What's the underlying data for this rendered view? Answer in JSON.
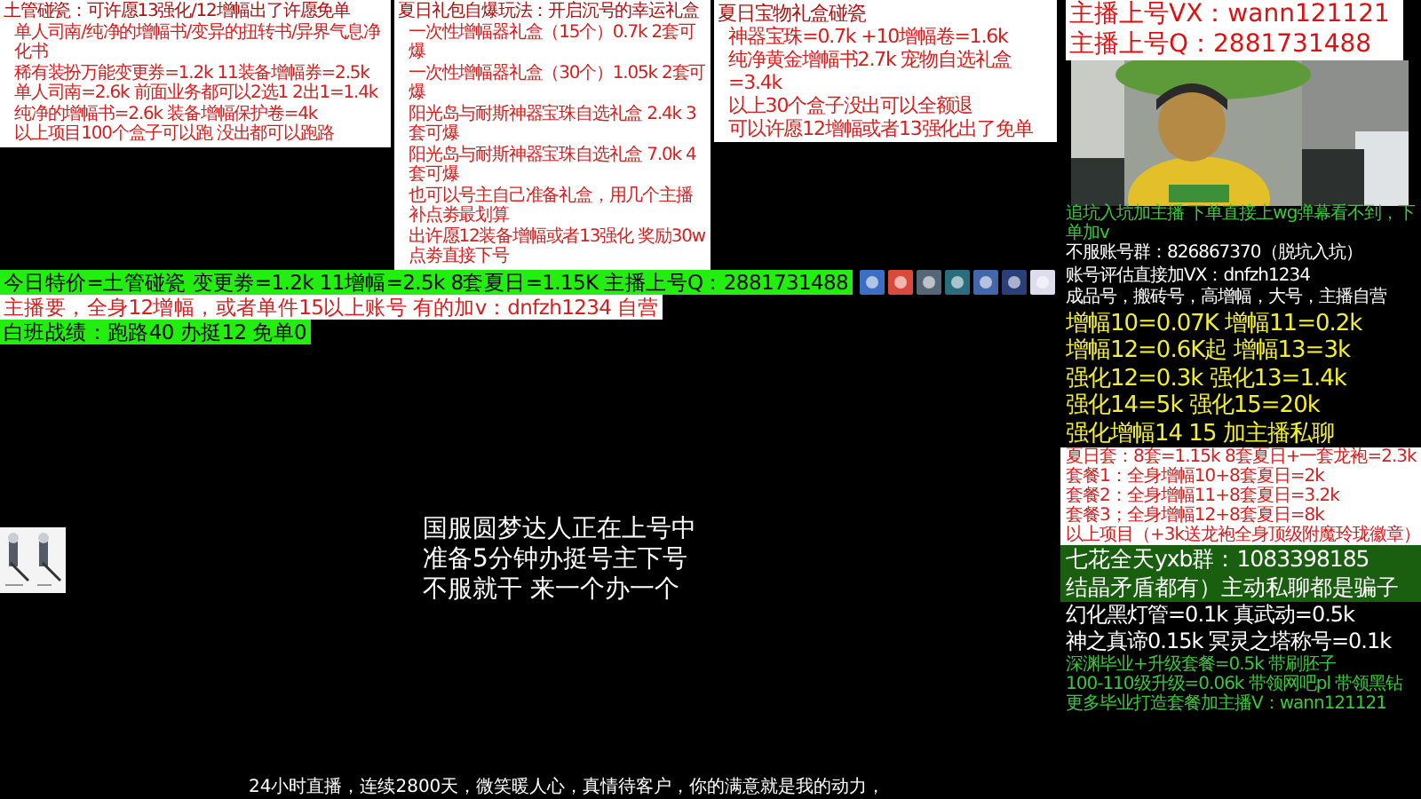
{
  "top_panels": [
    {
      "kind": "rules",
      "lines": [
        "土管碰瓷：可许愿13强化/12增幅出了许愿免单",
        "单人司南/纯净的增幅书/变异的扭转书/异界气息净化书",
        "稀有装扮万能变更券=1.2k  11装备增幅券=2.5k",
        "单人司南=2.6k 前面业务都可以2选1   2出1=1.4k",
        "纯净的增幅书=2.6k   装备增幅保护卷=4k",
        "以上项目100个盒子可以跑   没出都可以跑路"
      ]
    },
    {
      "kind": "rules",
      "lines": [
        "夏日礼包自爆玩法：开启沉号的幸运礼盒",
        "一次性增幅器礼盒（15个）0.7k   2套可爆",
        "一次性增幅器礼盒（30个）1.05k   2套可爆",
        "阳光岛与耐斯神器宝珠自选礼盒 2.4k 3套可爆",
        "阳光岛与耐斯神器宝珠自选礼盒 7.0k 4套可爆",
        "也可以号主自己准备礼盒，用几个主播补点劵最划算",
        "出许愿12装备增幅或者13强化 奖励30w点劵直接下号"
      ]
    },
    {
      "kind": "offer",
      "lines": [
        "夏日宝物礼盒碰瓷",
        "神器宝珠=0.7k   +10增幅卷=1.6k",
        "纯净黄金增幅书2.7k 宠物自选礼盒=3.4k",
        "以上30个盒子没出可以全额退",
        "可以许愿12增幅或者13强化出了免单"
      ]
    }
  ],
  "contact": {
    "lines": [
      "主播上号VX：wann121121",
      "主播上号Q：2881731488"
    ]
  },
  "banners": [
    {
      "kind": "green",
      "text": "今日特价=土管碰瓷  变更劵=1.2k  11增幅=2.5k  8套夏日=1.15K    主播上号Q：2881731488"
    },
    {
      "kind": "white",
      "text": "主播要，全身12增幅，或者单件15以上账号 有的加v：dnfzh1234 自营"
    },
    {
      "kind": "green",
      "text": "白班战绩：跑路40  办挺12  免单0"
    }
  ],
  "center_message": {
    "lines": [
      "国服圆梦达人正在上号中",
      "准备5分钟办挺号主下号",
      "不服就干 来一个办一个"
    ]
  },
  "caption": "24小时直播，连续2800天，微笑暖人心，真情待客户，你的满意就是我的动力，",
  "right_sections": [
    {
      "kind": "notice",
      "lines": [
        "追坑入坑加主播 下单直接上wg弹幕看不到，下单加v"
      ]
    },
    {
      "kind": "plain",
      "lines": [
        "不服账号群：826867370（脱坑入坑）",
        "账号评估直接加VX：dnfzh1234",
        "成品号，搬砖号，高增幅，大号，主播自营"
      ]
    },
    {
      "kind": "price",
      "lines": [
        "增幅10=0.07K  增幅11=0.2k",
        "增幅12=0.6K起 增幅13=3k",
        "强化12=0.3k   强化13=1.4k",
        "强化14=5k     强化15=20k",
        "强化增幅14  15  加主播私聊"
      ]
    },
    {
      "kind": "boxed",
      "lines": [
        "夏日套：8套=1.15k 8套夏日+一套龙袍=2.3k",
        "套餐1：全身增幅10+8套夏日=2k",
        "套餐2：全身增幅11+8套夏日=3.2k",
        "套餐3；全身增幅12+8套夏日=8k",
        "以上项目（+3k送龙袍全身顶级附魔玲珑徽章）"
      ]
    },
    {
      "kind": "group",
      "lines": [
        "七花全天yxb群：1083398185",
        "结晶矛盾都有）主动私聊都是骗子"
      ]
    },
    {
      "kind": "big",
      "lines": [
        "幻化黑灯管=0.1k 真武动=0.5k",
        "神之真谛0.15k 冥灵之塔称号=0.1k"
      ]
    },
    {
      "kind": "note",
      "lines": [
        "深渊毕业+升级套餐=0.5k 带刷胚子",
        "100-110级升级=0.06k 带领网吧pl 带领黑钻",
        "更多毕业打造套餐加主播V：wann121121"
      ]
    }
  ]
}
